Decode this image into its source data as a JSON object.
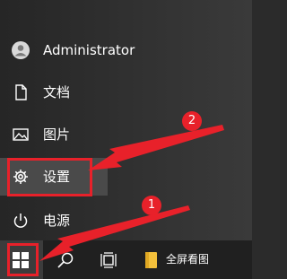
{
  "start_menu": {
    "account": {
      "label": "Administrator",
      "icon": "user-avatar-icon"
    },
    "items": [
      {
        "label": "文档",
        "icon": "document-icon"
      },
      {
        "label": "图片",
        "icon": "pictures-icon"
      },
      {
        "label": "设置",
        "icon": "gear-icon"
      },
      {
        "label": "电源",
        "icon": "power-icon"
      }
    ]
  },
  "taskbar": {
    "start_icon": "windows-logo-icon",
    "search_icon": "search-icon",
    "task_view_icon": "task-view-icon",
    "app": {
      "label": "全屏看图",
      "icon": "folder-icon"
    }
  },
  "annotations": {
    "steps": [
      {
        "number": "1",
        "target": "start-button"
      },
      {
        "number": "2",
        "target": "settings"
      }
    ],
    "highlight_color": "#e8212a"
  }
}
